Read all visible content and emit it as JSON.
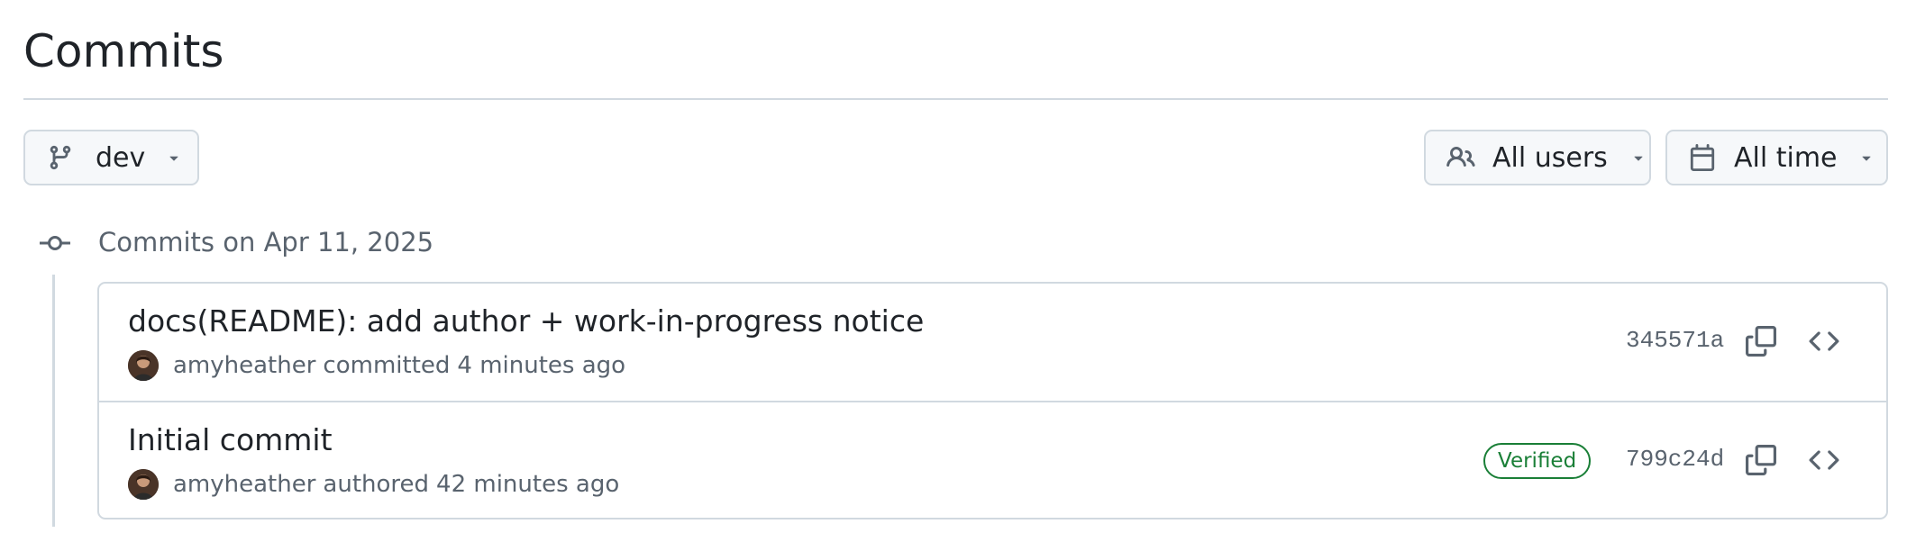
{
  "page": {
    "title": "Commits"
  },
  "filters": {
    "branch": {
      "label": "dev",
      "icon": "git-branch-icon"
    },
    "users": {
      "label": "All users",
      "icon": "people-icon"
    },
    "time": {
      "label": "All time",
      "icon": "calendar-icon"
    }
  },
  "groups": [
    {
      "heading": "Commits on Apr 11, 2025",
      "commits": [
        {
          "title": "docs(README): add author + work-in-progress notice",
          "author": "amyheather",
          "action": "committed",
          "time": "4 minutes ago",
          "sha": "345571a",
          "verified": false
        },
        {
          "title": "Initial commit",
          "author": "amyheather",
          "action": "authored",
          "time": "42 minutes ago",
          "sha": "799c24d",
          "verified": true,
          "badge": "Verified"
        }
      ]
    }
  ],
  "colors": {
    "text": "#1f2328",
    "muted": "#59636e",
    "border": "#d1d9e0",
    "button_bg": "#f6f8fa",
    "verified": "#1a7f37"
  }
}
